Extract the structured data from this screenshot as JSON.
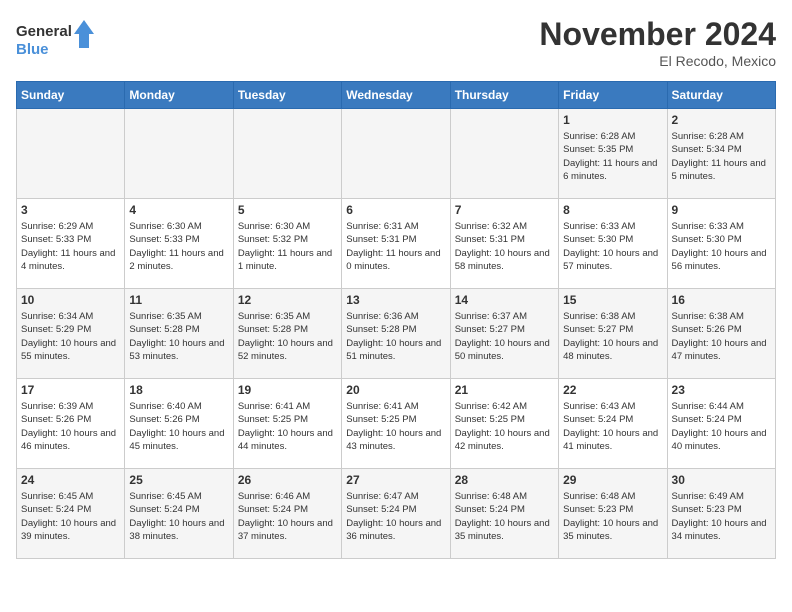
{
  "header": {
    "logo_line1": "General",
    "logo_line2": "Blue",
    "month": "November 2024",
    "location": "El Recodo, Mexico"
  },
  "weekdays": [
    "Sunday",
    "Monday",
    "Tuesday",
    "Wednesday",
    "Thursday",
    "Friday",
    "Saturday"
  ],
  "weeks": [
    [
      {
        "day": "",
        "info": ""
      },
      {
        "day": "",
        "info": ""
      },
      {
        "day": "",
        "info": ""
      },
      {
        "day": "",
        "info": ""
      },
      {
        "day": "",
        "info": ""
      },
      {
        "day": "1",
        "info": "Sunrise: 6:28 AM\nSunset: 5:35 PM\nDaylight: 11 hours and 6 minutes."
      },
      {
        "day": "2",
        "info": "Sunrise: 6:28 AM\nSunset: 5:34 PM\nDaylight: 11 hours and 5 minutes."
      }
    ],
    [
      {
        "day": "3",
        "info": "Sunrise: 6:29 AM\nSunset: 5:33 PM\nDaylight: 11 hours and 4 minutes."
      },
      {
        "day": "4",
        "info": "Sunrise: 6:30 AM\nSunset: 5:33 PM\nDaylight: 11 hours and 2 minutes."
      },
      {
        "day": "5",
        "info": "Sunrise: 6:30 AM\nSunset: 5:32 PM\nDaylight: 11 hours and 1 minute."
      },
      {
        "day": "6",
        "info": "Sunrise: 6:31 AM\nSunset: 5:31 PM\nDaylight: 11 hours and 0 minutes."
      },
      {
        "day": "7",
        "info": "Sunrise: 6:32 AM\nSunset: 5:31 PM\nDaylight: 10 hours and 58 minutes."
      },
      {
        "day": "8",
        "info": "Sunrise: 6:33 AM\nSunset: 5:30 PM\nDaylight: 10 hours and 57 minutes."
      },
      {
        "day": "9",
        "info": "Sunrise: 6:33 AM\nSunset: 5:30 PM\nDaylight: 10 hours and 56 minutes."
      }
    ],
    [
      {
        "day": "10",
        "info": "Sunrise: 6:34 AM\nSunset: 5:29 PM\nDaylight: 10 hours and 55 minutes."
      },
      {
        "day": "11",
        "info": "Sunrise: 6:35 AM\nSunset: 5:28 PM\nDaylight: 10 hours and 53 minutes."
      },
      {
        "day": "12",
        "info": "Sunrise: 6:35 AM\nSunset: 5:28 PM\nDaylight: 10 hours and 52 minutes."
      },
      {
        "day": "13",
        "info": "Sunrise: 6:36 AM\nSunset: 5:28 PM\nDaylight: 10 hours and 51 minutes."
      },
      {
        "day": "14",
        "info": "Sunrise: 6:37 AM\nSunset: 5:27 PM\nDaylight: 10 hours and 50 minutes."
      },
      {
        "day": "15",
        "info": "Sunrise: 6:38 AM\nSunset: 5:27 PM\nDaylight: 10 hours and 48 minutes."
      },
      {
        "day": "16",
        "info": "Sunrise: 6:38 AM\nSunset: 5:26 PM\nDaylight: 10 hours and 47 minutes."
      }
    ],
    [
      {
        "day": "17",
        "info": "Sunrise: 6:39 AM\nSunset: 5:26 PM\nDaylight: 10 hours and 46 minutes."
      },
      {
        "day": "18",
        "info": "Sunrise: 6:40 AM\nSunset: 5:26 PM\nDaylight: 10 hours and 45 minutes."
      },
      {
        "day": "19",
        "info": "Sunrise: 6:41 AM\nSunset: 5:25 PM\nDaylight: 10 hours and 44 minutes."
      },
      {
        "day": "20",
        "info": "Sunrise: 6:41 AM\nSunset: 5:25 PM\nDaylight: 10 hours and 43 minutes."
      },
      {
        "day": "21",
        "info": "Sunrise: 6:42 AM\nSunset: 5:25 PM\nDaylight: 10 hours and 42 minutes."
      },
      {
        "day": "22",
        "info": "Sunrise: 6:43 AM\nSunset: 5:24 PM\nDaylight: 10 hours and 41 minutes."
      },
      {
        "day": "23",
        "info": "Sunrise: 6:44 AM\nSunset: 5:24 PM\nDaylight: 10 hours and 40 minutes."
      }
    ],
    [
      {
        "day": "24",
        "info": "Sunrise: 6:45 AM\nSunset: 5:24 PM\nDaylight: 10 hours and 39 minutes."
      },
      {
        "day": "25",
        "info": "Sunrise: 6:45 AM\nSunset: 5:24 PM\nDaylight: 10 hours and 38 minutes."
      },
      {
        "day": "26",
        "info": "Sunrise: 6:46 AM\nSunset: 5:24 PM\nDaylight: 10 hours and 37 minutes."
      },
      {
        "day": "27",
        "info": "Sunrise: 6:47 AM\nSunset: 5:24 PM\nDaylight: 10 hours and 36 minutes."
      },
      {
        "day": "28",
        "info": "Sunrise: 6:48 AM\nSunset: 5:24 PM\nDaylight: 10 hours and 35 minutes."
      },
      {
        "day": "29",
        "info": "Sunrise: 6:48 AM\nSunset: 5:23 PM\nDaylight: 10 hours and 35 minutes."
      },
      {
        "day": "30",
        "info": "Sunrise: 6:49 AM\nSunset: 5:23 PM\nDaylight: 10 hours and 34 minutes."
      }
    ]
  ]
}
